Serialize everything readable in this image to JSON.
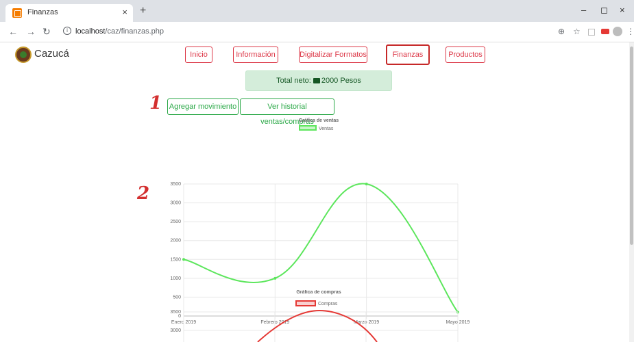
{
  "browser": {
    "tab_title": "Finanzas",
    "tab_close": "×",
    "new_tab": "+",
    "url_host": "localhost",
    "url_path": "/caz/finanzas.php",
    "url_info": "i",
    "minimize": "–",
    "restore": "◻",
    "close": "×"
  },
  "header": {
    "brand": "Cazucá",
    "nav": [
      {
        "label": "Inicio"
      },
      {
        "label": "Información"
      },
      {
        "label": "Digitalizar Formatos"
      },
      {
        "label": "Finanzas"
      },
      {
        "label": "Productos"
      }
    ]
  },
  "total": {
    "label": "Total neto:",
    "value": "2000 Pesos"
  },
  "actions": {
    "add_movement": "Agregar movimiento",
    "history": "Ver historial ventas/compras"
  },
  "annotations": {
    "one": "1",
    "two": "2"
  },
  "colors": {
    "sales": "#5ce65c",
    "purchases": "#e53935",
    "danger": "#dc3545",
    "success": "#28a745"
  },
  "chart_data": [
    {
      "type": "line",
      "title": "Gráfica de ventas",
      "categories": [
        "Enero 2019",
        "Febrero 2019",
        "Marzo 2019",
        "Mayo 2019"
      ],
      "series": [
        {
          "name": "Ventas",
          "values": [
            1500,
            1000,
            3500,
            100
          ]
        }
      ],
      "ylim": [
        0,
        3500
      ],
      "yticks": [
        "3500",
        "3000",
        "2500",
        "2000",
        "1500",
        "1000",
        "500",
        "0"
      ],
      "legend": "top",
      "grid": true
    },
    {
      "type": "line",
      "title": "Gráfica de compras",
      "categories": [],
      "series": [
        {
          "name": "Compras",
          "values": []
        }
      ],
      "ylim": [
        0,
        3500
      ],
      "yticks": [
        "3500",
        "3000"
      ],
      "legend": "top",
      "grid": true
    }
  ]
}
